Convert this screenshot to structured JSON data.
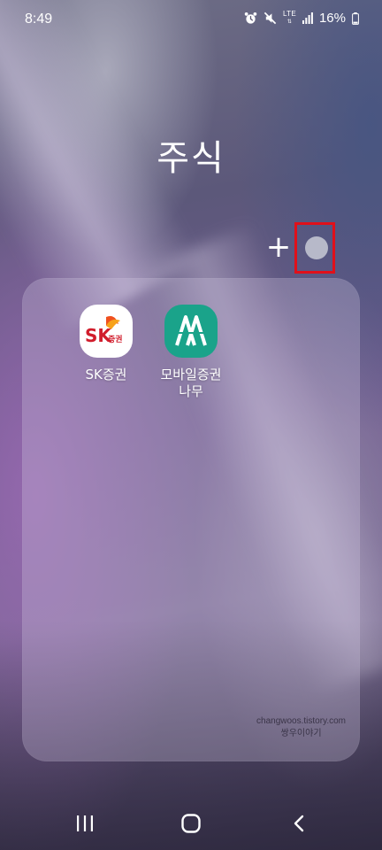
{
  "status_bar": {
    "time": "8:49",
    "network_label": "LTE",
    "network_sub": "",
    "battery_percent": "16%",
    "icons": [
      "alarm-icon",
      "mute-icon",
      "lte-icon",
      "signal-icon",
      "battery-icon"
    ]
  },
  "folder": {
    "title": "주식",
    "add_button_label": "+",
    "color_button_color": "#b7b9c9",
    "highlight_color": "#e0101a",
    "apps": [
      {
        "label": "SK증권",
        "icon": "sk-securities-icon",
        "icon_text": "SK",
        "icon_sub_text": "증권"
      },
      {
        "label": "모바일증권\n나무",
        "line1": "모바일증권",
        "line2": "나무",
        "icon": "namu-icon",
        "icon_color": "#1aa38a"
      }
    ]
  },
  "watermark": {
    "line1": "changwoos.tistory.com",
    "line2": "쌍우이야기"
  },
  "nav_bar": {
    "buttons": [
      "recents-icon",
      "home-icon",
      "back-icon"
    ]
  }
}
